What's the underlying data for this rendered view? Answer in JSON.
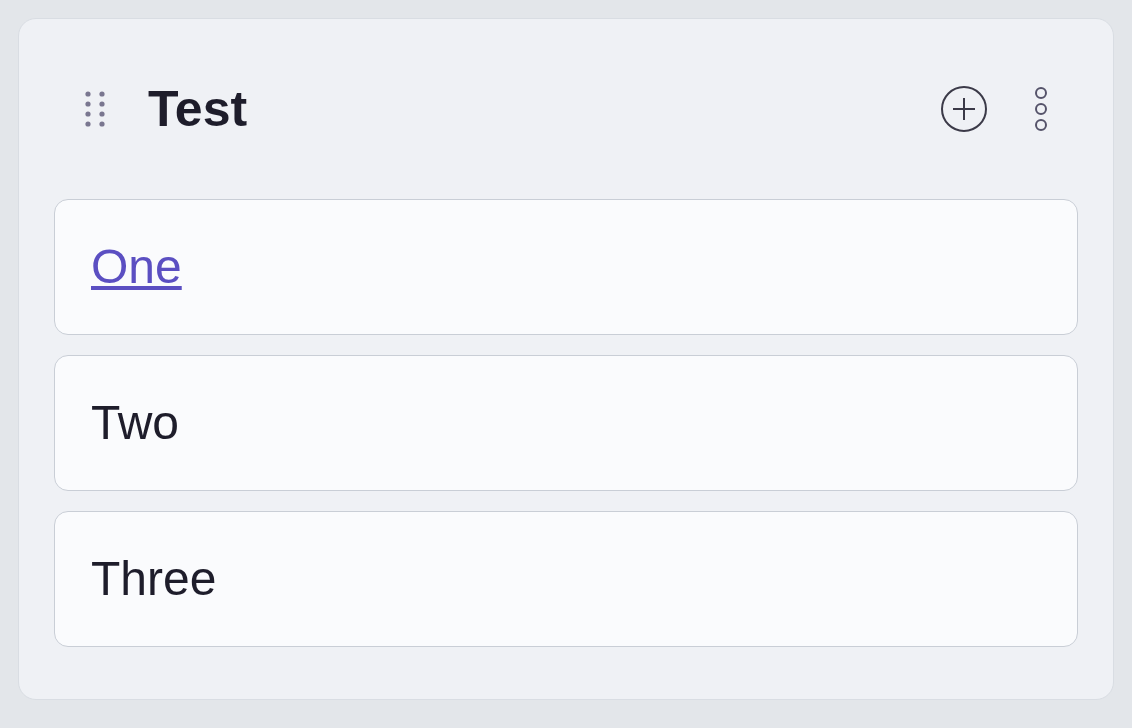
{
  "list": {
    "title": "Test",
    "items": [
      {
        "label": "One",
        "kind": "link"
      },
      {
        "label": "Two",
        "kind": "text"
      },
      {
        "label": "Three",
        "kind": "text"
      }
    ]
  }
}
